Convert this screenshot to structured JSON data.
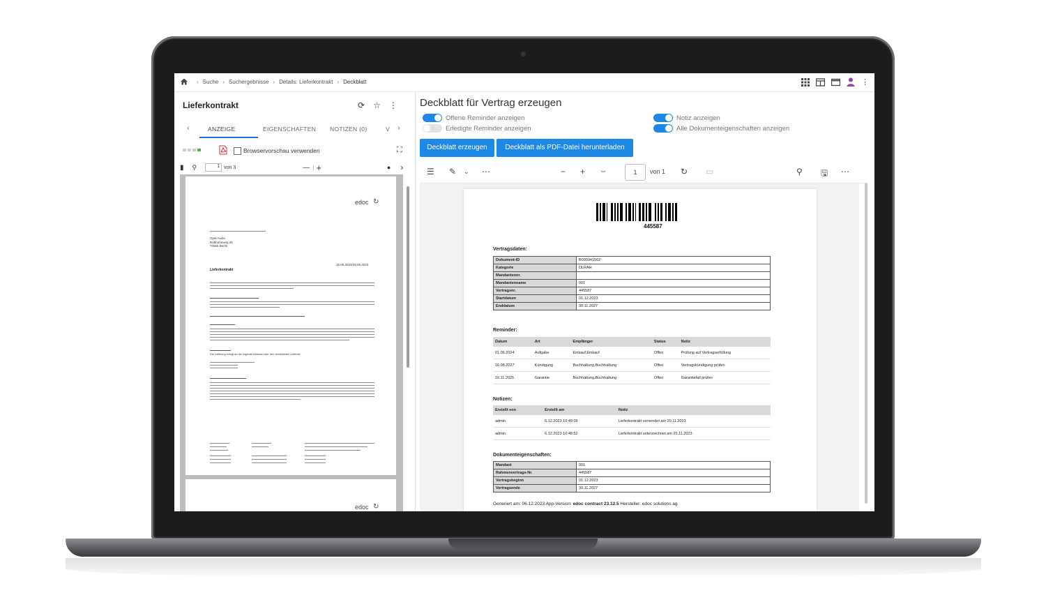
{
  "breadcrumb": {
    "items": [
      "Suche",
      "Suchergebnisse",
      "Details: Lieferkontrakt",
      "Deckblatt"
    ]
  },
  "left_panel": {
    "title": "Lieferkontrakt",
    "tabs": [
      "ANZEIGE",
      "EIGENSCHAFTEN",
      "NOTIZEN (0)",
      "V"
    ],
    "browser_preview_label": "Browservorschau verwenden",
    "page_input": "1",
    "page_total": "von 3",
    "zoom_minus": "—",
    "zoom_plus": "+",
    "preview_logo": "edoc",
    "preview_date": "15.06.2023/29.06.2023",
    "preview_heading": "Lieferkontrakt",
    "preview_address": [
      "Opal Audio",
      "Rabhuhnweg 45",
      "70565 Berlin"
    ],
    "preview_delivery": "Die Lieferung erfolgt an die folgende Adresse oder den vereinbarten Lieferort:"
  },
  "right_panel": {
    "title": "Deckblatt für Vertrag erzeugen",
    "toggles": {
      "open_reminders": {
        "label": "Offene Reminder anzeigen",
        "on": true
      },
      "done_reminders": {
        "label": "Erledigte Reminder anzeigen",
        "on": false
      },
      "show_note": {
        "label": "Notiz anzeigen",
        "on": true
      },
      "all_props": {
        "label": "Alle Dokumenteigenschaften anzeigen",
        "on": true
      }
    },
    "buttons": {
      "create": "Deckblatt erzeugen",
      "download": "Deckblatt als PDF-Datei herunterladen"
    },
    "pdf_toolbar": {
      "page": "1",
      "of": "von 1"
    }
  },
  "cover_sheet": {
    "barcode_number": "445587",
    "contract_heading": "Vertragsdaten:",
    "contract_data": [
      {
        "key": "Dokument-ID",
        "value": "B000341562"
      },
      {
        "key": "Kategorie",
        "value": "DLRAH"
      },
      {
        "key": "Mandantennr.",
        "value": ""
      },
      {
        "key": "Mandantenname",
        "value": "001"
      },
      {
        "key": "Vertragsnr.",
        "value": "445587"
      },
      {
        "key": "Startdatum",
        "value": "01.12.2023"
      },
      {
        "key": "Enddatum",
        "value": "30.11.2027"
      }
    ],
    "reminder_heading": "Reminder:",
    "reminder_columns": [
      "Datum",
      "Art",
      "Empfänger",
      "Status",
      "Notiz"
    ],
    "reminders": [
      [
        "01.06.2024",
        "Aufgabe",
        "Einkauf,Einkauf",
        "Offen",
        "Prüfung auf Vertragserfüllung"
      ],
      [
        "16.08.2027",
        "Kündigung",
        "Buchhaltung,Buchhaltung",
        "Offen",
        "Vertragskündigung prüfen"
      ],
      [
        "16.11.2025",
        "Garantie",
        "Buchhaltung,Buchhaltung",
        "Offen",
        "Garantiefall prüfen"
      ]
    ],
    "notes_heading": "Notizen:",
    "notes_columns": [
      "Erstellt von",
      "Erstellt am",
      "Notiz"
    ],
    "notes": [
      [
        "admin",
        "6.12.2023 10:49:09",
        "Lieferkontrakt versendet am 20.11.2023"
      ],
      [
        "admin",
        "6.12.2023 10:48:52",
        "Lieferkontrakt unterzeichnet am 25.11.2023"
      ]
    ],
    "props_heading": "Dokumenteigenschaften:",
    "props": [
      {
        "key": "Mandant",
        "value": "001"
      },
      {
        "key": "Rahmenvertrags-Nr.",
        "value": "445587"
      },
      {
        "key": "Vertragsbeginn",
        "value": "01.12.2023"
      },
      {
        "key": "Vertragsende",
        "value": "30.11.2027"
      }
    ],
    "footer_generated": "Generiert am: 06.12.2023 App-Version:",
    "footer_app": "edoc contract 23.12.5",
    "footer_vendor": "Hersteller: edoc solutions ag"
  },
  "colors": {
    "accent": "#1e88e5",
    "frame": "#1c1c1e"
  }
}
